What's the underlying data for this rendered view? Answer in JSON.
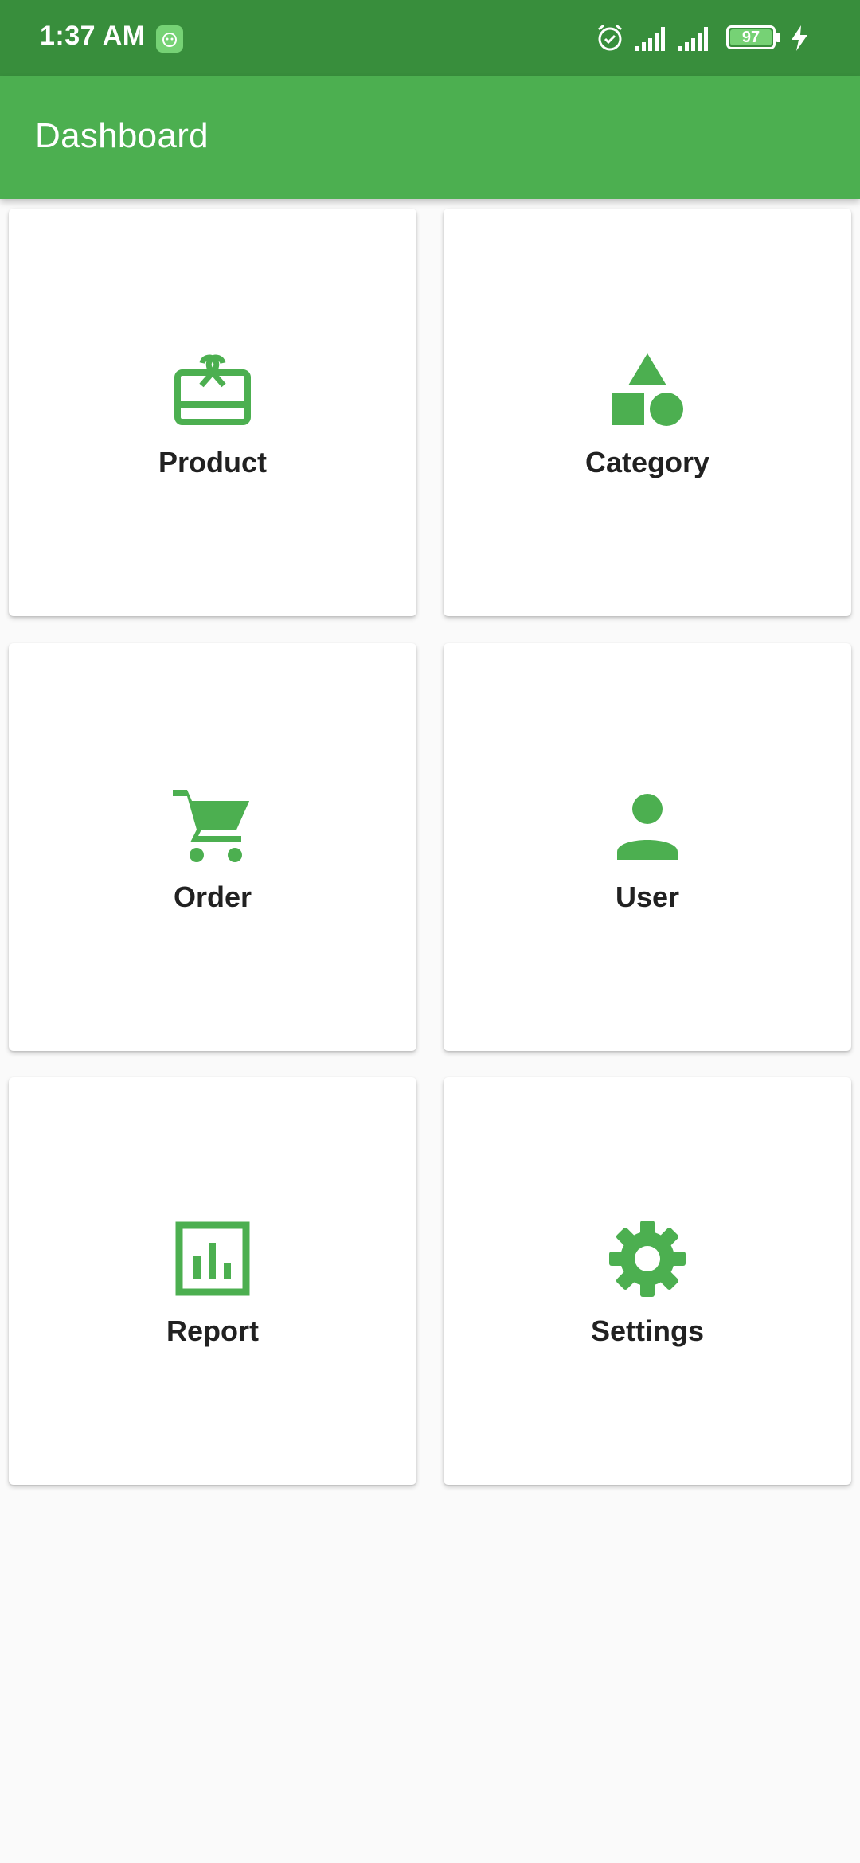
{
  "status_bar": {
    "time": "1:37 AM",
    "battery": "97",
    "icons": [
      "app-notification-icon",
      "alarm-icon",
      "signal-icon",
      "signal-icon",
      "battery-icon",
      "charging-icon"
    ]
  },
  "app_bar": {
    "title": "Dashboard"
  },
  "colors": {
    "primary": "#4caf50",
    "primary_dark": "#388e3c",
    "label": "#212121",
    "background": "#fafafa"
  },
  "tiles": [
    {
      "label": "Product",
      "icon": "gift-card-icon"
    },
    {
      "label": "Category",
      "icon": "shapes-icon"
    },
    {
      "label": "Order",
      "icon": "shopping-cart-icon"
    },
    {
      "label": "User",
      "icon": "person-icon"
    },
    {
      "label": "Report",
      "icon": "bar-chart-icon"
    },
    {
      "label": "Settings",
      "icon": "gear-icon"
    }
  ]
}
